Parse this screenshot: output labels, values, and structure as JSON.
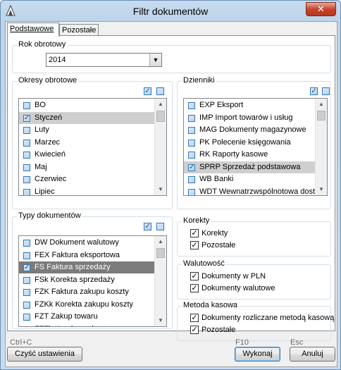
{
  "window": {
    "title": "Filtr dokumentów",
    "close_label": "✕"
  },
  "tabs": [
    {
      "label": "Podstawowe",
      "active": true
    },
    {
      "label": "Pozostałe",
      "active": false
    }
  ],
  "rok": {
    "title": "Rok obrotowy",
    "value": "2014"
  },
  "okresy": {
    "title": "Okresy obrotowe",
    "items": [
      {
        "label": "BO",
        "checked": false,
        "selected": false
      },
      {
        "label": "Styczeń",
        "checked": true,
        "selected": true
      },
      {
        "label": "Luty",
        "checked": false,
        "selected": false
      },
      {
        "label": "Marzec",
        "checked": false,
        "selected": false
      },
      {
        "label": "Kwiecień",
        "checked": false,
        "selected": false
      },
      {
        "label": "Maj",
        "checked": false,
        "selected": false
      },
      {
        "label": "Czerwiec",
        "checked": false,
        "selected": false
      },
      {
        "label": "Lipiec",
        "checked": false,
        "selected": false
      }
    ]
  },
  "dzienniki": {
    "title": "Dzienniki",
    "items": [
      {
        "label": "EXP Eksport",
        "checked": false,
        "selected": false
      },
      {
        "label": "IMP Import towarów i usług",
        "checked": false,
        "selected": false
      },
      {
        "label": "MAG Dokumenty magazynowe",
        "checked": false,
        "selected": false
      },
      {
        "label": "PK Polecenie księgowania",
        "checked": false,
        "selected": false
      },
      {
        "label": "RK Raporty kasowe",
        "checked": false,
        "selected": false
      },
      {
        "label": "SPRP Sprzedaż podstawowa",
        "checked": true,
        "selected": true
      },
      {
        "label": "WB Banki",
        "checked": false,
        "selected": false
      },
      {
        "label": "WDT Wewnatrzwspólnotowa dosta",
        "checked": false,
        "selected": false
      }
    ]
  },
  "typy": {
    "title": "Typy dokumentów",
    "items": [
      {
        "label": "DW Dokument walutowy",
        "checked": false,
        "selected": false
      },
      {
        "label": "FEX Faktura eksportowa",
        "checked": false,
        "selected": false
      },
      {
        "label": "FS Faktura sprzedaży",
        "checked": true,
        "selected": true
      },
      {
        "label": "FSk Korekta sprzedaży",
        "checked": false,
        "selected": false
      },
      {
        "label": "FZK Faktura zakupu koszty",
        "checked": false,
        "selected": false
      },
      {
        "label": "FZKk Korekta zakupu koszty",
        "checked": false,
        "selected": false
      },
      {
        "label": "FZT Zakup towaru",
        "checked": false,
        "selected": false
      },
      {
        "label": "FZTk Korekta zakupu towaru",
        "checked": false,
        "selected": false
      }
    ]
  },
  "korekty": {
    "title": "Korekty",
    "options": [
      {
        "label": "Korekty",
        "checked": true
      },
      {
        "label": "Pozostałe",
        "checked": true
      }
    ]
  },
  "walutowosc": {
    "title": "Walutowość",
    "options": [
      {
        "label": "Dokumenty w PLN",
        "checked": true
      },
      {
        "label": "Dokumenty walutowe",
        "checked": true
      }
    ]
  },
  "metoda": {
    "title": "Metoda kasowa",
    "options": [
      {
        "label": "Dokumenty rozliczane metodą kasową",
        "checked": true
      },
      {
        "label": "Pozostałe",
        "checked": true
      }
    ]
  },
  "footer": {
    "clear_hint": "Ctrl+C",
    "clear_label": "Czyść ustawienia",
    "run_hint": "F10",
    "run_label": "Wykonaj",
    "cancel_hint": "Esc",
    "cancel_label": "Anuluj"
  }
}
